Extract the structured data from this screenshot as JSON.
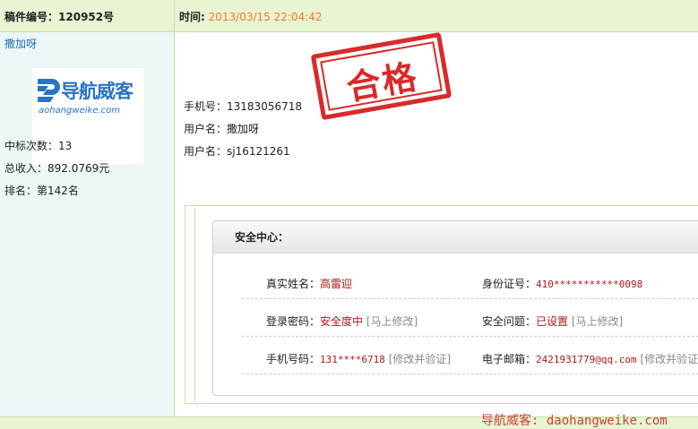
{
  "header": {
    "doc_no_label": "稿件编号：",
    "doc_no": "120952号",
    "time_label": "时间:",
    "time_value": "2013/03/15 22:04:42"
  },
  "sidebar": {
    "username": "撒加呀",
    "logo": {
      "cn": "导航威客",
      "en": "aohangweike.com"
    },
    "wins_label": "中标次数：",
    "wins": "13",
    "income_label": "总收入：",
    "income": "892.0769元",
    "rank_label": "排名：",
    "rank": "第142名"
  },
  "main": {
    "stamp": "合格",
    "phone_label": "手机号：",
    "phone": "13183056718",
    "username_label": "用户名：",
    "username": "撒加呀",
    "username2_label": "用户名：",
    "username2": "sj16121261"
  },
  "security": {
    "title": "安全中心：",
    "real_name_label": "真实姓名：",
    "real_name": "高雷迎",
    "id_label": "身份证号：",
    "id": "410***********0098",
    "pwd_label": "登录密码：",
    "pwd_status": "安全度中",
    "pwd_action": "[马上修改]",
    "question_label": "安全问题：",
    "question_status": "已设置",
    "question_action": "[马上修改]",
    "mobile_label": "手机号码：",
    "mobile": "131****6718",
    "mobile_action": "[修改并验证]",
    "email_label": "电子邮箱：",
    "email": "2421931779@qq.com",
    "email_action": "[修改并验证"
  },
  "watermark": "导航威客: daohangweike.com",
  "colors": {
    "accent_orange": "#f07a2a",
    "stamp_red": "#d92a2a",
    "value_red": "#b01818",
    "header_green": "#e8f4d2",
    "link_blue": "#1f6fb2"
  }
}
